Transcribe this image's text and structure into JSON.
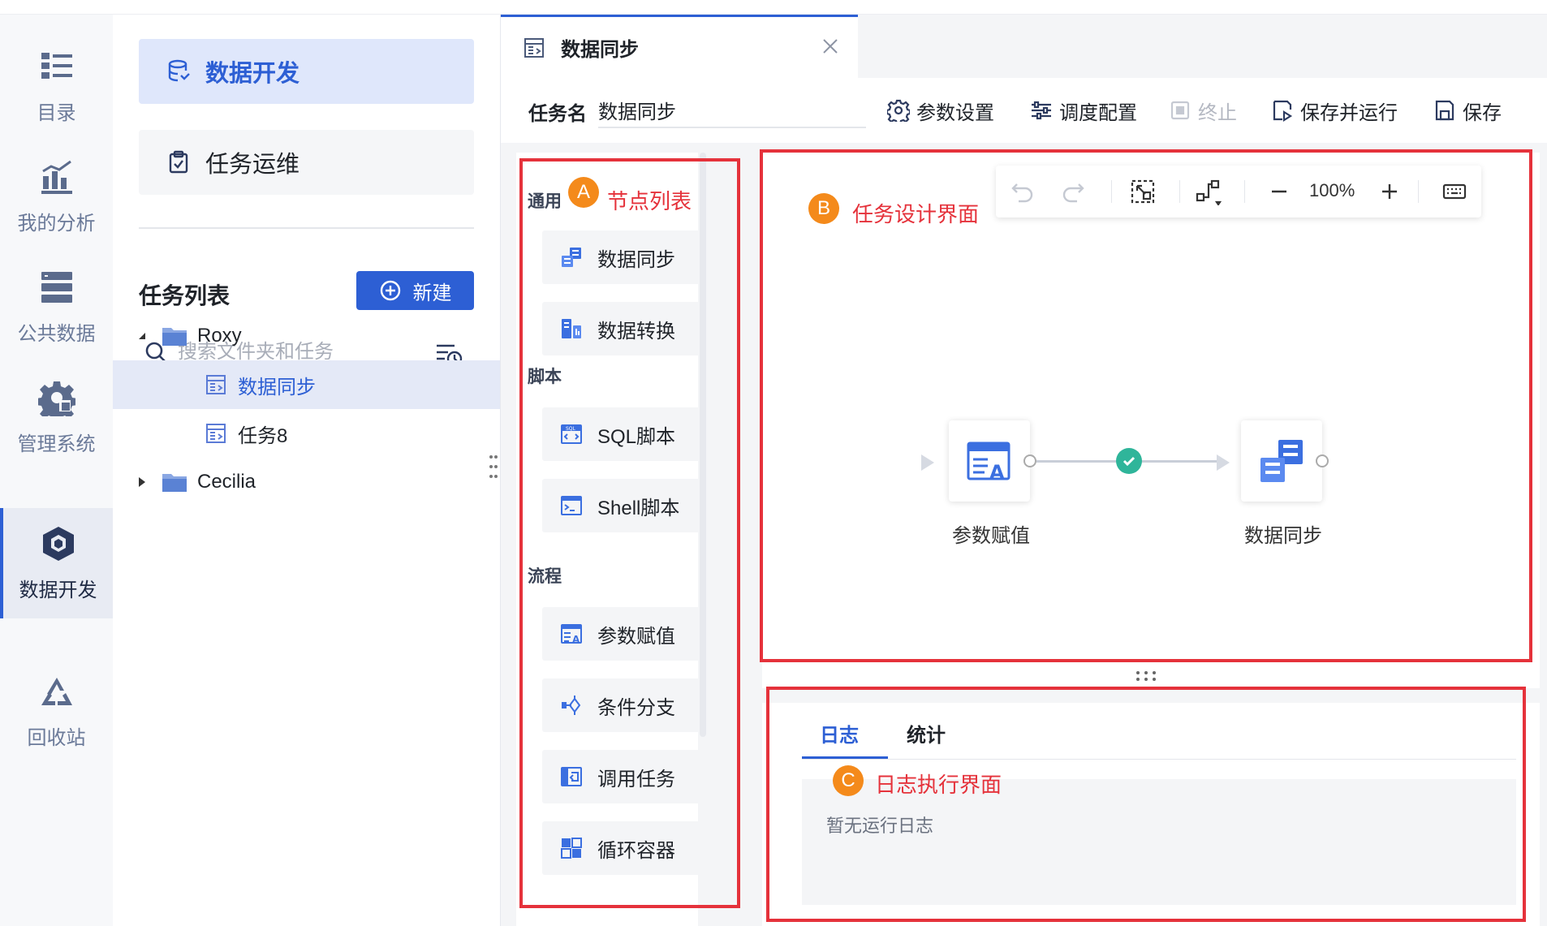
{
  "nav": [
    {
      "label": "目录",
      "icon": "catalog-icon"
    },
    {
      "label": "我的分析",
      "icon": "analysis-icon"
    },
    {
      "label": "公共数据",
      "icon": "public-data-icon"
    },
    {
      "label": "管理系统",
      "icon": "gear-icon"
    },
    {
      "label": "数据开发",
      "icon": "cube-icon",
      "active": true
    },
    {
      "label": "回收站",
      "icon": "recycle-icon"
    }
  ],
  "panel": {
    "menu_dev": "数据开发",
    "menu_ops": "任务运维",
    "list_title": "任务列表",
    "new_label": "新建",
    "search_placeholder": "搜索文件夹和任务",
    "tree": [
      {
        "label": "Roxy",
        "type": "folder",
        "expanded": true
      },
      {
        "label": "数据同步",
        "type": "task",
        "selected": true
      },
      {
        "label": "任务8",
        "type": "task"
      },
      {
        "label": "Cecilia",
        "type": "folder",
        "expanded": false
      }
    ]
  },
  "tab": {
    "title": "数据同步"
  },
  "toolbar": {
    "task_name_label": "任务名",
    "task_name_value": "数据同步",
    "buttons": [
      {
        "label": "参数设置",
        "icon": "gear-icon"
      },
      {
        "label": "调度配置",
        "icon": "sliders-icon"
      },
      {
        "label": "终止",
        "icon": "stop-icon",
        "disabled": true
      },
      {
        "label": "保存并运行",
        "icon": "save-run-icon"
      },
      {
        "label": "保存",
        "icon": "save-icon"
      }
    ]
  },
  "nodelist": {
    "groups": [
      {
        "label": "通用",
        "items": [
          "数据同步",
          "数据转换"
        ]
      },
      {
        "label": "脚本",
        "items": [
          "SQL脚本",
          "Shell脚本"
        ]
      },
      {
        "label": "流程",
        "items": [
          "参数赋值",
          "条件分支",
          "调用任务",
          "循环容器"
        ]
      }
    ]
  },
  "canvas": {
    "zoom": "100%",
    "nodes": [
      {
        "label": "参数赋值",
        "icon": "param-assign-icon"
      },
      {
        "label": "数据同步",
        "icon": "data-sync-icon"
      }
    ]
  },
  "log": {
    "tabs": [
      "日志",
      "统计"
    ],
    "active_tab": "日志",
    "empty_text": "暂无运行日志"
  },
  "annotations": {
    "a": {
      "badge": "A",
      "text": "节点列表"
    },
    "b": {
      "badge": "B",
      "text": "任务设计界面"
    },
    "c": {
      "badge": "C",
      "text": "日志执行界面"
    }
  },
  "colors": {
    "accent": "#2d5fd4",
    "annotation_red": "#e5323b",
    "badge_orange": "#f48a1b",
    "success_green": "#2fb59a"
  }
}
